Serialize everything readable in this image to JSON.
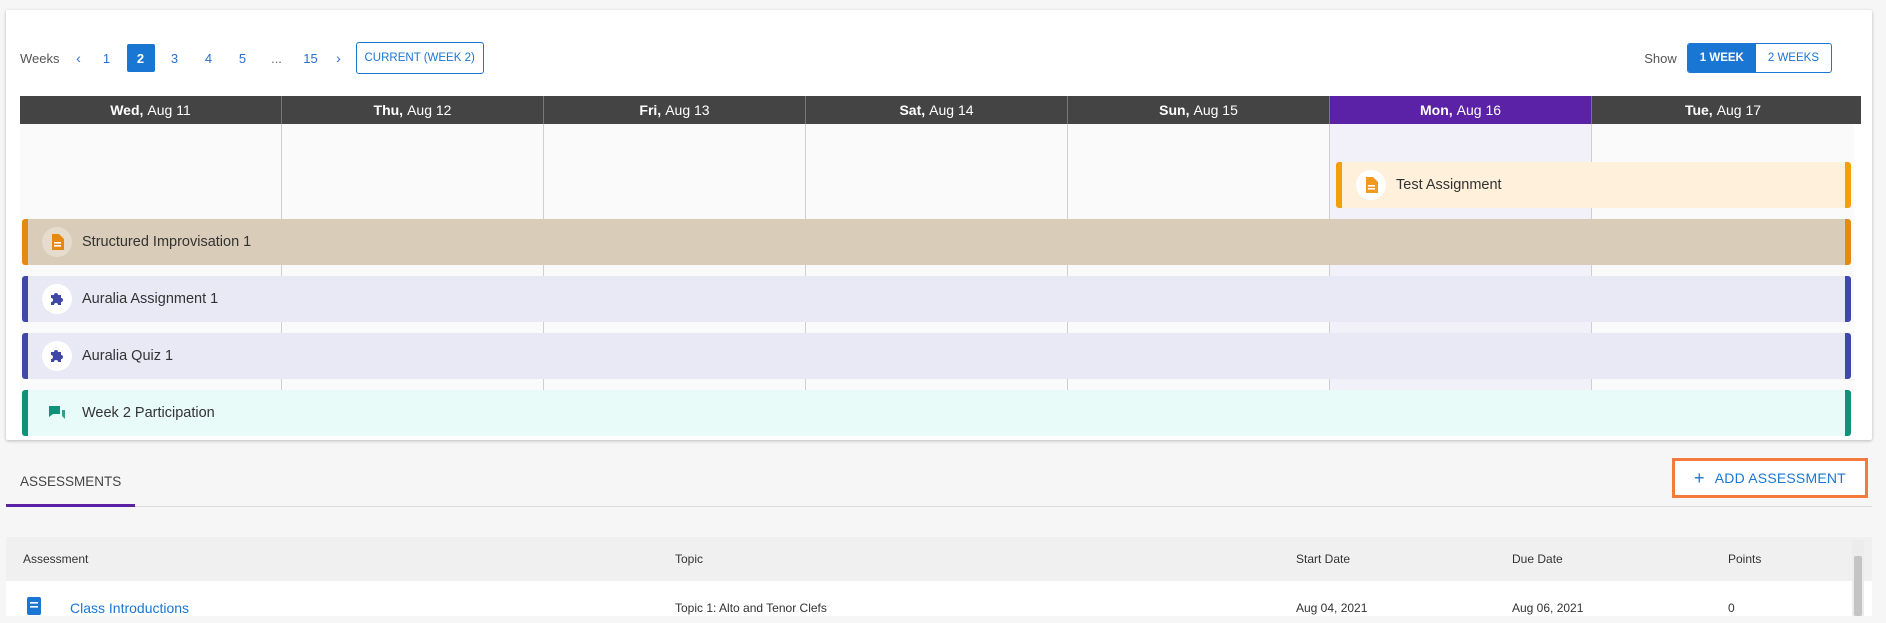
{
  "pager": {
    "label": "Weeks",
    "pages": [
      "1",
      "2",
      "3",
      "4",
      "5",
      "...",
      "15"
    ],
    "active": "2",
    "current_button": "CURRENT (WEEK 2)"
  },
  "show": {
    "label": "Show",
    "one_week": "1 WEEK",
    "two_weeks": "2 WEEKS"
  },
  "calendar": {
    "days": [
      {
        "dow": "Wed,",
        "date": "Aug 11"
      },
      {
        "dow": "Thu,",
        "date": "Aug 12"
      },
      {
        "dow": "Fri,",
        "date": "Aug 13"
      },
      {
        "dow": "Sat,",
        "date": "Aug 14"
      },
      {
        "dow": "Sun,",
        "date": "Aug 15"
      },
      {
        "dow": "Mon,",
        "date": "Aug 16"
      },
      {
        "dow": "Tue,",
        "date": "Aug 17"
      }
    ],
    "today_index": 5,
    "events": [
      {
        "title": "Test Assignment",
        "icon": "document-icon"
      },
      {
        "title": "Structured Improvisation 1",
        "icon": "document-icon"
      },
      {
        "title": "Auralia Assignment 1",
        "icon": "puzzle-icon"
      },
      {
        "title": "Auralia Quiz 1",
        "icon": "puzzle-icon"
      },
      {
        "title": "Week 2 Participation",
        "icon": "chat-icon"
      }
    ]
  },
  "tabs": {
    "assessments": "ASSESSMENTS"
  },
  "add_assessment": "ADD ASSESSMENT",
  "table": {
    "headers": {
      "assessment": "Assessment",
      "topic": "Topic",
      "start": "Start Date",
      "due": "Due Date",
      "points": "Points"
    },
    "rows": [
      {
        "assessment": "Class Introductions",
        "topic": "Topic 1: Alto and Tenor Clefs",
        "start": "Aug 04, 2021",
        "due": "Aug 06, 2021",
        "points": "0"
      }
    ]
  },
  "colors": {
    "today_header": "#5b21a6",
    "accent": "#1976d2",
    "highlight": "#f47b3b"
  }
}
